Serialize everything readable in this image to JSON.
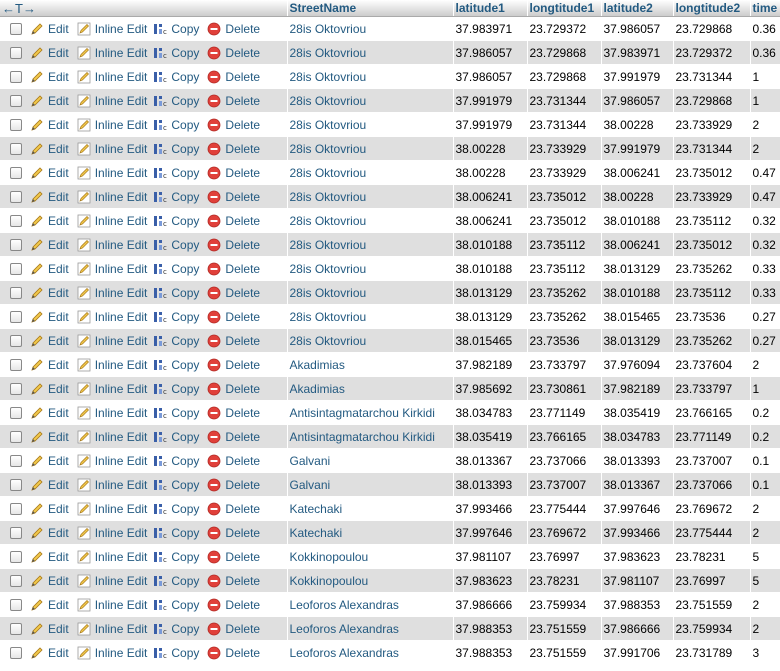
{
  "header": {
    "nav": "←T→",
    "columns": [
      "StreetName",
      "latitude1",
      "longtitude1",
      "latitude2",
      "longtitude2",
      "time"
    ]
  },
  "actions": {
    "edit": "Edit",
    "inline_edit": "Inline Edit",
    "copy": "Copy",
    "delete": "Delete"
  },
  "rows": [
    [
      "28is Oktovriou",
      "37.983971",
      "23.729372",
      "37.986057",
      "23.729868",
      "0.36"
    ],
    [
      "28is Oktovriou",
      "37.986057",
      "23.729868",
      "37.983971",
      "23.729372",
      "0.36"
    ],
    [
      "28is Oktovriou",
      "37.986057",
      "23.729868",
      "37.991979",
      "23.731344",
      "1"
    ],
    [
      "28is Oktovriou",
      "37.991979",
      "23.731344",
      "37.986057",
      "23.729868",
      "1"
    ],
    [
      "28is Oktovriou",
      "37.991979",
      "23.731344",
      "38.00228",
      "23.733929",
      "2"
    ],
    [
      "28is Oktovriou",
      "38.00228",
      "23.733929",
      "37.991979",
      "23.731344",
      "2"
    ],
    [
      "28is Oktovriou",
      "38.00228",
      "23.733929",
      "38.006241",
      "23.735012",
      "0.47"
    ],
    [
      "28is Oktovriou",
      "38.006241",
      "23.735012",
      "38.00228",
      "23.733929",
      "0.47"
    ],
    [
      "28is Oktovriou",
      "38.006241",
      "23.735012",
      "38.010188",
      "23.735112",
      "0.32"
    ],
    [
      "28is Oktovriou",
      "38.010188",
      "23.735112",
      "38.006241",
      "23.735012",
      "0.32"
    ],
    [
      "28is Oktovriou",
      "38.010188",
      "23.735112",
      "38.013129",
      "23.735262",
      "0.33"
    ],
    [
      "28is Oktovriou",
      "38.013129",
      "23.735262",
      "38.010188",
      "23.735112",
      "0.33"
    ],
    [
      "28is Oktovriou",
      "38.013129",
      "23.735262",
      "38.015465",
      "23.73536",
      "0.27"
    ],
    [
      "28is Oktovriou",
      "38.015465",
      "23.73536",
      "38.013129",
      "23.735262",
      "0.27"
    ],
    [
      "Akadimias",
      "37.982189",
      "23.733797",
      "37.976094",
      "23.737604",
      "2"
    ],
    [
      "Akadimias",
      "37.985692",
      "23.730861",
      "37.982189",
      "23.733797",
      "1"
    ],
    [
      "Antisintagmatarchou Kirkidi",
      "38.034783",
      "23.771149",
      "38.035419",
      "23.766165",
      "0.2"
    ],
    [
      "Antisintagmatarchou Kirkidi",
      "38.035419",
      "23.766165",
      "38.034783",
      "23.771149",
      "0.2"
    ],
    [
      "Galvani",
      "38.013367",
      "23.737066",
      "38.013393",
      "23.737007",
      "0.1"
    ],
    [
      "Galvani",
      "38.013393",
      "23.737007",
      "38.013367",
      "23.737066",
      "0.1"
    ],
    [
      "Katechaki",
      "37.993466",
      "23.775444",
      "37.997646",
      "23.769672",
      "2"
    ],
    [
      "Katechaki",
      "37.997646",
      "23.769672",
      "37.993466",
      "23.775444",
      "2"
    ],
    [
      "Kokkinopoulou",
      "37.981107",
      "23.76997",
      "37.983623",
      "23.78231",
      "5"
    ],
    [
      "Kokkinopoulou",
      "37.983623",
      "23.78231",
      "37.981107",
      "23.76997",
      "5"
    ],
    [
      "Leoforos Alexandras",
      "37.986666",
      "23.759934",
      "37.988353",
      "23.751559",
      "2"
    ],
    [
      "Leoforos Alexandras",
      "37.988353",
      "23.751559",
      "37.986666",
      "23.759934",
      "2"
    ],
    [
      "Leoforos Alexandras",
      "37.988353",
      "23.751559",
      "37.991706",
      "23.731789",
      "3"
    ]
  ]
}
